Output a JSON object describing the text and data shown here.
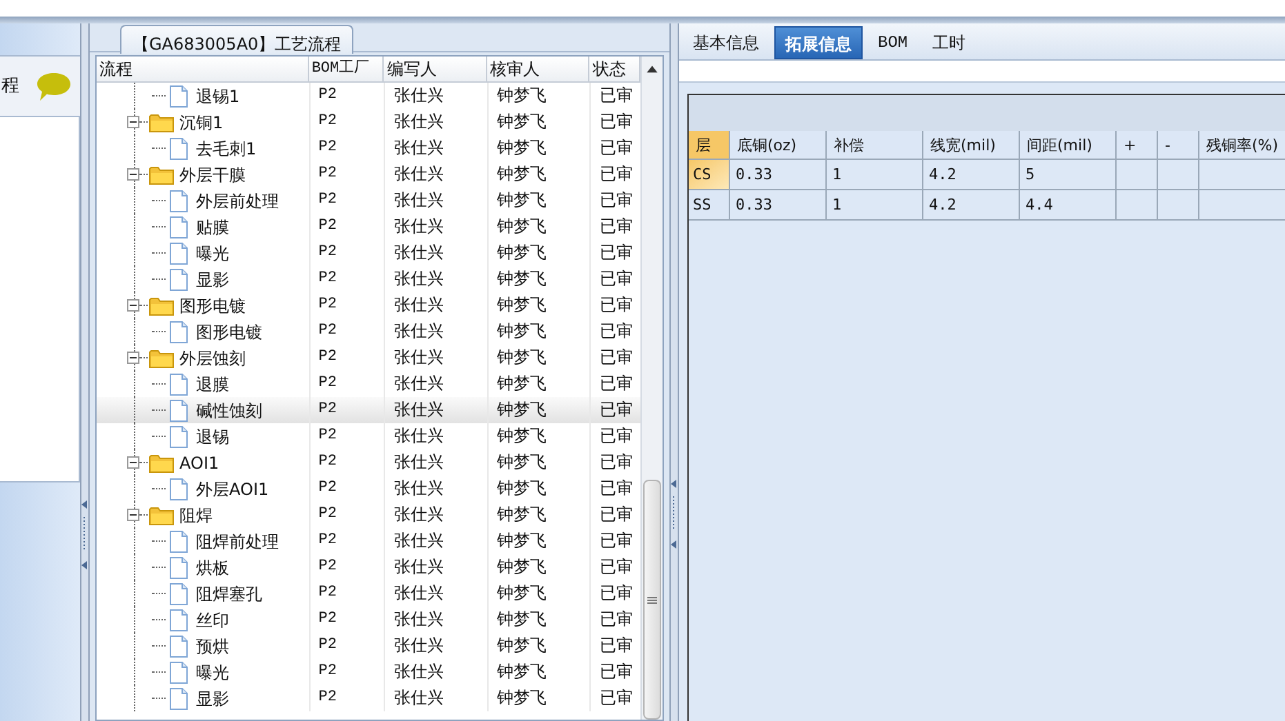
{
  "left_panel": {
    "title": "程"
  },
  "process_tab": {
    "title": "【GA683005A0】工艺流程"
  },
  "tree": {
    "label_column": "流程",
    "columns": [
      "BOM工厂",
      "编写人",
      "核审人",
      "状态"
    ],
    "rows": [
      {
        "kind": "leaf",
        "label": "退锡1",
        "cells": [
          "P2",
          "张仕兴",
          "钟梦飞",
          "已审"
        ],
        "selected": false
      },
      {
        "kind": "folder",
        "label": "沉铜1",
        "cells": [
          "P2",
          "张仕兴",
          "钟梦飞",
          "已审"
        ],
        "expanded": true,
        "selected": false,
        "children": [
          {
            "kind": "leaf",
            "label": "去毛刺1",
            "cells": [
              "P2",
              "张仕兴",
              "钟梦飞",
              "已审"
            ],
            "selected": false
          }
        ]
      },
      {
        "kind": "folder",
        "label": "外层干膜",
        "cells": [
          "P2",
          "张仕兴",
          "钟梦飞",
          "已审"
        ],
        "expanded": true,
        "selected": false,
        "children": [
          {
            "kind": "leaf",
            "label": "外层前处理",
            "cells": [
              "P2",
              "张仕兴",
              "钟梦飞",
              "已审"
            ],
            "selected": false
          },
          {
            "kind": "leaf",
            "label": "贴膜",
            "cells": [
              "P2",
              "张仕兴",
              "钟梦飞",
              "已审"
            ],
            "selected": false
          },
          {
            "kind": "leaf",
            "label": "曝光",
            "cells": [
              "P2",
              "张仕兴",
              "钟梦飞",
              "已审"
            ],
            "selected": false
          },
          {
            "kind": "leaf",
            "label": "显影",
            "cells": [
              "P2",
              "张仕兴",
              "钟梦飞",
              "已审"
            ],
            "selected": false
          }
        ]
      },
      {
        "kind": "folder",
        "label": "图形电镀",
        "cells": [
          "P2",
          "张仕兴",
          "钟梦飞",
          "已审"
        ],
        "expanded": true,
        "selected": false,
        "children": [
          {
            "kind": "leaf",
            "label": "图形电镀",
            "cells": [
              "P2",
              "张仕兴",
              "钟梦飞",
              "已审"
            ],
            "selected": false
          }
        ]
      },
      {
        "kind": "folder",
        "label": "外层蚀刻",
        "cells": [
          "P2",
          "张仕兴",
          "钟梦飞",
          "已审"
        ],
        "expanded": true,
        "selected": false,
        "children": [
          {
            "kind": "leaf",
            "label": "退膜",
            "cells": [
              "P2",
              "张仕兴",
              "钟梦飞",
              "已审"
            ],
            "selected": false
          },
          {
            "kind": "leaf",
            "label": "碱性蚀刻",
            "cells": [
              "P2",
              "张仕兴",
              "钟梦飞",
              "已审"
            ],
            "selected": true
          },
          {
            "kind": "leaf",
            "label": "退锡",
            "cells": [
              "P2",
              "张仕兴",
              "钟梦飞",
              "已审"
            ],
            "selected": false
          }
        ]
      },
      {
        "kind": "folder",
        "label": "AOI1",
        "cells": [
          "P2",
          "张仕兴",
          "钟梦飞",
          "已审"
        ],
        "expanded": true,
        "selected": false,
        "children": [
          {
            "kind": "leaf",
            "label": "外层AOI1",
            "cells": [
              "P2",
              "张仕兴",
              "钟梦飞",
              "已审"
            ],
            "selected": false
          }
        ]
      },
      {
        "kind": "folder",
        "label": "阻焊",
        "cells": [
          "P2",
          "张仕兴",
          "钟梦飞",
          "已审"
        ],
        "expanded": true,
        "selected": false,
        "children": [
          {
            "kind": "leaf",
            "label": "阻焊前处理",
            "cells": [
              "P2",
              "张仕兴",
              "钟梦飞",
              "已审"
            ],
            "selected": false
          },
          {
            "kind": "leaf",
            "label": "烘板",
            "cells": [
              "P2",
              "张仕兴",
              "钟梦飞",
              "已审"
            ],
            "selected": false
          },
          {
            "kind": "leaf",
            "label": "阻焊塞孔",
            "cells": [
              "P2",
              "张仕兴",
              "钟梦飞",
              "已审"
            ],
            "selected": false
          },
          {
            "kind": "leaf",
            "label": "丝印",
            "cells": [
              "P2",
              "张仕兴",
              "钟梦飞",
              "已审"
            ],
            "selected": false
          },
          {
            "kind": "leaf",
            "label": "预烘",
            "cells": [
              "P2",
              "张仕兴",
              "钟梦飞",
              "已审"
            ],
            "selected": false
          },
          {
            "kind": "leaf",
            "label": "曝光",
            "cells": [
              "P2",
              "张仕兴",
              "钟梦飞",
              "已审"
            ],
            "selected": false
          },
          {
            "kind": "leaf",
            "label": "显影",
            "cells": [
              "P2",
              "张仕兴",
              "钟梦飞",
              "已审"
            ],
            "selected": false
          }
        ]
      }
    ]
  },
  "tabs": [
    {
      "label": "基本信息",
      "selected": false
    },
    {
      "label": "拓展信息",
      "selected": true
    },
    {
      "label": "BOM",
      "selected": false
    },
    {
      "label": "工时",
      "selected": false
    }
  ],
  "layer_table": {
    "columns": [
      "层",
      "底铜(oz)",
      "补偿",
      "线宽(mil)",
      "间距(mil)",
      "+",
      "-",
      "残铜率(%)"
    ],
    "rows": [
      {
        "cells": [
          "CS",
          "0.33",
          "1",
          "4.2",
          "5"
        ],
        "selected": true
      },
      {
        "cells": [
          "SS",
          "0.33",
          "1",
          "4.2",
          "4.4"
        ],
        "selected": false
      }
    ]
  }
}
